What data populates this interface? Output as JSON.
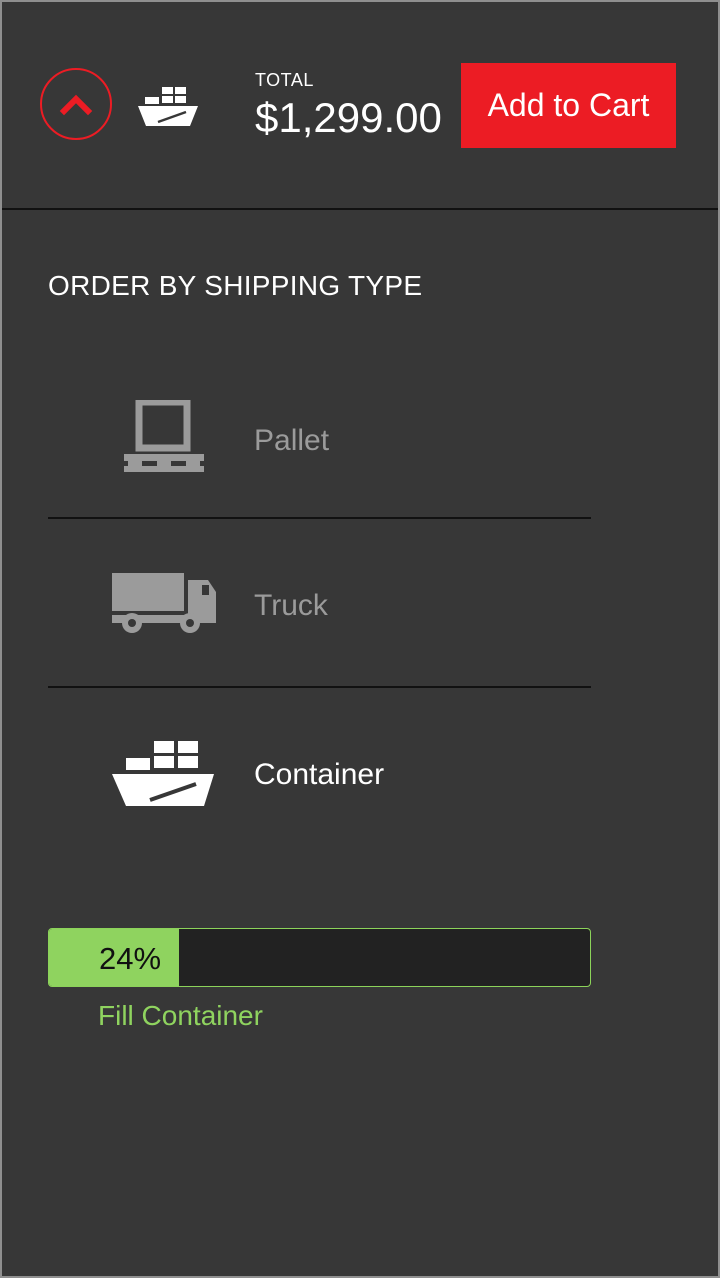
{
  "header": {
    "total_label": "TOTAL",
    "total_value": "$1,299.00",
    "add_to_cart_label": "Add to Cart",
    "collapse_icon": "chevron-up-icon",
    "shipping_icon": "container-ship-icon"
  },
  "section": {
    "title": "ORDER BY SHIPPING TYPE",
    "options": [
      {
        "label": "Pallet",
        "icon": "pallet-icon",
        "selected": false
      },
      {
        "label": "Truck",
        "icon": "truck-icon",
        "selected": false
      },
      {
        "label": "Container",
        "icon": "container-ship-icon",
        "selected": true
      }
    ]
  },
  "progress": {
    "percent_label": "24%",
    "value": 24,
    "action_label": "Fill Container"
  },
  "colors": {
    "background": "#373737",
    "accent_red": "#ec1c24",
    "progress_green": "#8fd35f",
    "inactive_text": "#9b9b9b",
    "active_text": "#ffffff"
  }
}
